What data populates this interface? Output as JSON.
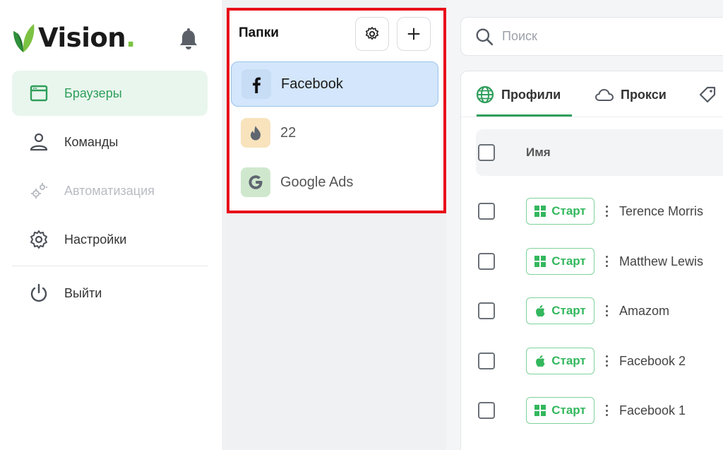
{
  "brand": {
    "name": "Vision",
    "dot": "."
  },
  "sidebar": {
    "items": [
      {
        "label": "Браузеры",
        "icon": "browser-window-icon",
        "state": "active"
      },
      {
        "label": "Команды",
        "icon": "user-icon",
        "state": "normal"
      },
      {
        "label": "Автоматизация",
        "icon": "gears-icon",
        "state": "disabled"
      },
      {
        "label": "Настройки",
        "icon": "gear-icon",
        "state": "normal"
      },
      {
        "label": "Выйти",
        "icon": "power-icon",
        "state": "normal"
      }
    ]
  },
  "folders": {
    "title": "Папки",
    "items": [
      {
        "label": "Facebook",
        "icon": "facebook-icon",
        "selected": true
      },
      {
        "label": "22",
        "icon": "flame-icon",
        "selected": false
      },
      {
        "label": "Google Ads",
        "icon": "google-icon",
        "selected": false
      }
    ]
  },
  "search": {
    "placeholder": "Поиск"
  },
  "tabs": [
    {
      "label": "Профили",
      "icon": "globe-icon",
      "active": true
    },
    {
      "label": "Прокси",
      "icon": "cloud-icon",
      "active": false
    }
  ],
  "table": {
    "header": "Имя",
    "start_label": "Старт",
    "rows": [
      {
        "name": "Terence Morris",
        "os": "windows-icon"
      },
      {
        "name": "Matthew Lewis",
        "os": "windows-icon"
      },
      {
        "name": "Amazom",
        "os": "apple-icon"
      },
      {
        "name": "Facebook 2",
        "os": "apple-icon"
      },
      {
        "name": "Facebook 1",
        "os": "windows-icon"
      }
    ]
  },
  "colors": {
    "accent": "#2f9e5b",
    "start": "#33b75d",
    "highlight_border": "#e8101a",
    "selected_folder": "#d3e6fb"
  }
}
